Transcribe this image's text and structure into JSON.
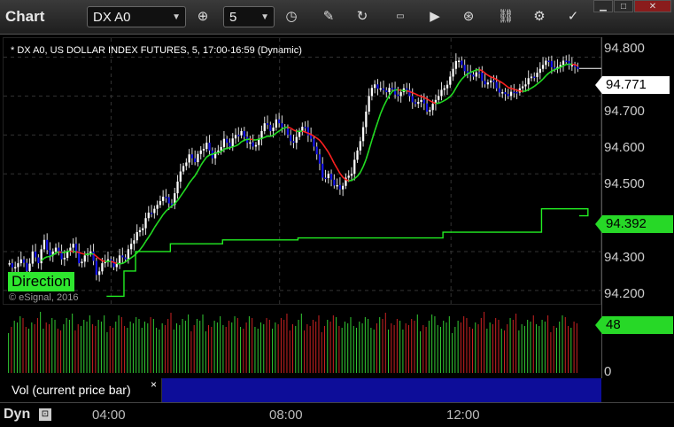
{
  "toolbar": {
    "title": "Chart",
    "symbol": "DX A0",
    "interval": "5",
    "icons": [
      "crosshair-icon",
      "clock-icon",
      "pencil-icon",
      "refresh-icon",
      "ticker-icon",
      "play-icon",
      "alert-icon",
      "link-icon",
      "settings-icon",
      "pin-icon"
    ],
    "window_buttons": [
      "minimize",
      "maximize",
      "close"
    ]
  },
  "chart": {
    "title": "* DX A0, US DOLLAR INDEX FUTURES, 5, 17:00-16:59 (Dynamic)",
    "direction_label": "Direction",
    "copyright": "© eSignal, 2016",
    "last_price_tag": "94.771",
    "indicator_tag": "94.392",
    "price_labels": [
      "94.800",
      "94.700",
      "94.600",
      "94.500",
      "94.300",
      "94.200"
    ]
  },
  "volume": {
    "label": "Vol (current price bar)",
    "value_tag": "48",
    "axis_zero": "0",
    "close_glyph": "×"
  },
  "time_axis": {
    "labels": [
      "04:00",
      "08:00",
      "12:00"
    ],
    "mode_label": "Dyn"
  },
  "chart_data": {
    "type": "candlestick",
    "title": "* DX A0, US DOLLAR INDEX FUTURES, 5, 17:00-16:59 (Dynamic)",
    "ylim": [
      94.17,
      94.84
    ],
    "x_ticks": [
      "04:00",
      "08:00",
      "12:00"
    ],
    "closes": [
      94.27,
      94.26,
      94.28,
      94.25,
      94.3,
      94.27,
      94.33,
      94.29,
      94.31,
      94.28,
      94.3,
      94.32,
      94.27,
      94.29,
      94.3,
      94.24,
      94.27,
      94.28,
      94.26,
      94.29,
      94.28,
      94.32,
      94.35,
      94.36,
      94.4,
      94.41,
      94.43,
      94.44,
      94.42,
      94.48,
      94.52,
      94.55,
      94.53,
      94.56,
      94.58,
      94.54,
      94.56,
      94.59,
      94.57,
      94.6,
      94.61,
      94.58,
      94.57,
      94.59,
      94.63,
      94.61,
      94.64,
      94.62,
      94.6,
      94.58,
      94.61,
      94.62,
      94.59,
      94.55,
      94.49,
      94.5,
      94.47,
      94.46,
      94.49,
      94.5,
      94.56,
      94.62,
      94.7,
      94.73,
      94.72,
      94.71,
      94.72,
      94.7,
      94.72,
      94.7,
      94.68,
      94.69,
      94.66,
      94.68,
      94.7,
      94.72,
      94.75,
      94.79,
      94.78,
      94.76,
      94.75,
      94.76,
      94.73,
      94.74,
      94.72,
      94.71,
      94.7,
      94.71,
      94.72,
      94.73,
      94.75,
      94.76,
      94.78,
      94.79,
      94.77,
      94.78,
      94.79,
      94.78,
      94.77
    ],
    "trailing_stop": [
      {
        "from_bar": 34,
        "value": 94.185
      },
      {
        "from_bar": 40,
        "value": 94.25
      },
      {
        "from_bar": 44,
        "value": 94.3
      },
      {
        "from_bar": 56,
        "value": 94.32
      },
      {
        "from_bar": 74,
        "value": 94.33
      },
      {
        "from_bar": 100,
        "value": 94.335
      },
      {
        "from_bar": 150,
        "value": 94.35
      },
      {
        "from_bar": 184,
        "value": 94.41
      },
      {
        "from_bar": 200,
        "value": 94.392
      }
    ],
    "last_price": 94.771,
    "indicator_value": 94.392,
    "volume_last": 48
  },
  "colors": {
    "background": "#000000",
    "up_candle": "#ffffff",
    "down_candle": "#1414e6",
    "ma_up": "#22dd22",
    "ma_down": "#ff2020",
    "trailing": "#22ee22",
    "vol_up": "#33cc33",
    "vol_down": "#cc2222"
  }
}
